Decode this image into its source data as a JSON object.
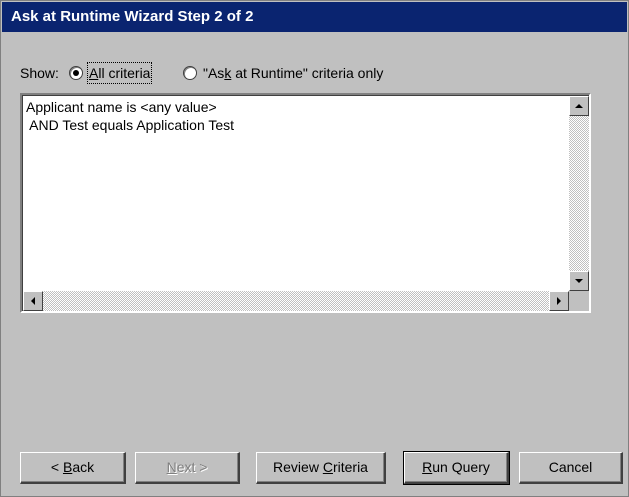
{
  "window": {
    "title": "Ask at Runtime Wizard Step 2 of 2"
  },
  "show": {
    "label": "Show:",
    "options": [
      {
        "pre": "",
        "key": "A",
        "post": "ll criteria",
        "selected": true
      },
      {
        "pre": "\"As",
        "key": "k",
        "post": " at Runtime\" criteria only",
        "selected": false
      }
    ]
  },
  "criteria": {
    "lines": [
      "Applicant name is <any value>",
      " AND Test equals Application Test"
    ]
  },
  "buttons": {
    "back": {
      "pre": "< ",
      "key": "B",
      "post": "ack",
      "enabled": true
    },
    "next": {
      "pre": "",
      "key": "N",
      "post": "ext >",
      "enabled": false
    },
    "review": {
      "pre": "Review ",
      "key": "C",
      "post": "riteria",
      "enabled": true
    },
    "run": {
      "pre": "",
      "key": "R",
      "post": "un Query",
      "enabled": true,
      "default": true
    },
    "cancel": {
      "label": "Cancel",
      "enabled": true
    }
  },
  "colors": {
    "titlebar": "#0a2470",
    "face": "#c0c0c0"
  }
}
